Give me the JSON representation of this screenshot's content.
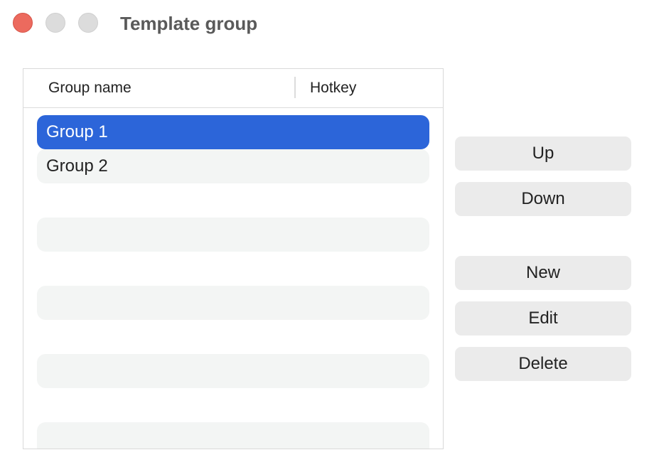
{
  "window": {
    "title": "Template group"
  },
  "table": {
    "columns": [
      "Group name",
      "Hotkey"
    ],
    "rows": [
      {
        "name": "Group 1",
        "hotkey": ""
      },
      {
        "name": "Group 2",
        "hotkey": ""
      }
    ],
    "selected_index": 0
  },
  "buttons": {
    "up": "Up",
    "down": "Down",
    "new": "New",
    "edit": "Edit",
    "delete": "Delete"
  },
  "colors": {
    "selection": "#2c65d9",
    "row_stripe": "#f3f5f4",
    "close": "#ec6a5e",
    "button_bg": "#ebebeb"
  }
}
